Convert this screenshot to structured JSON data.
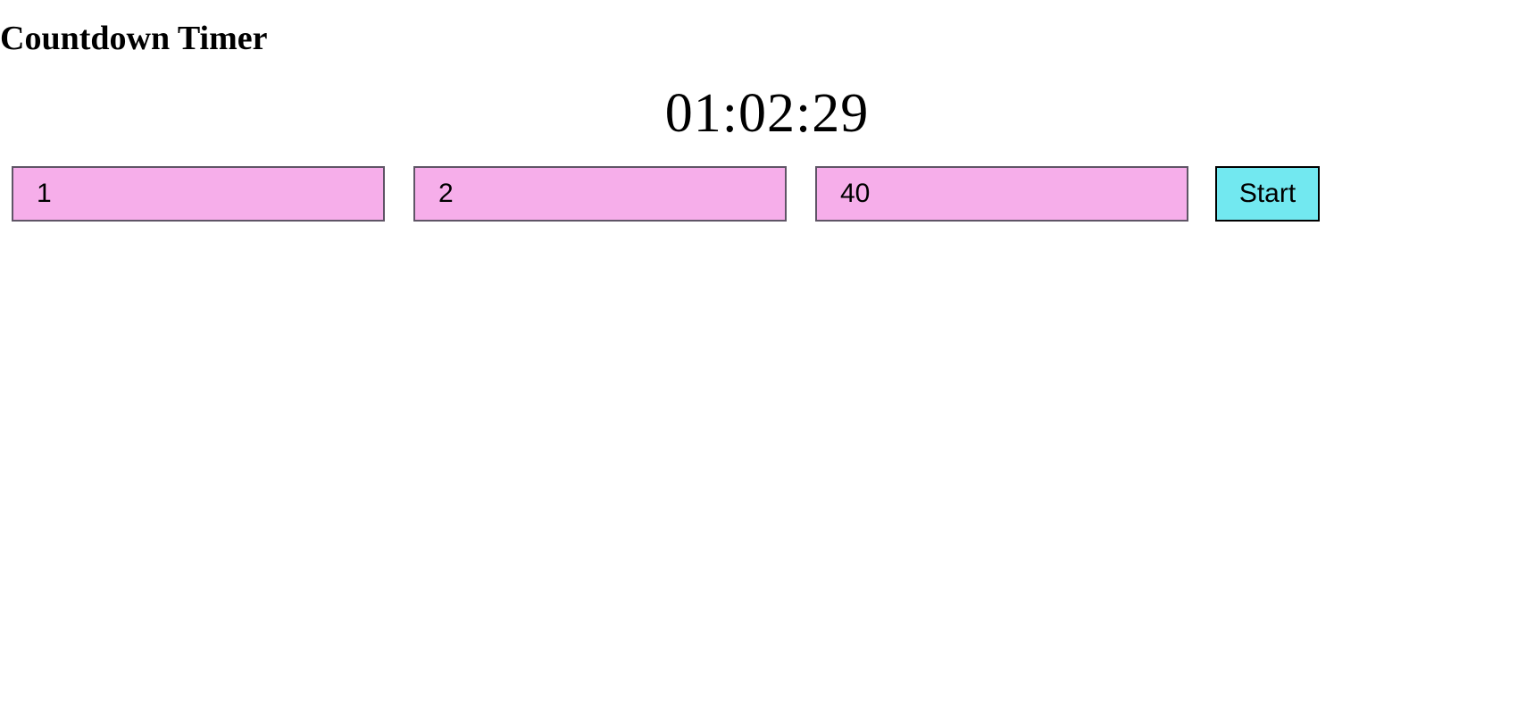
{
  "page": {
    "title": "Countdown Timer"
  },
  "timer": {
    "display": "01:02:29"
  },
  "inputs": {
    "hours": "1",
    "minutes": "2",
    "seconds": "40"
  },
  "controls": {
    "start_label": "Start"
  },
  "colors": {
    "input_background": "#f6aeea",
    "button_background": "#72e8f0",
    "text": "#000000",
    "page_background": "#ffffff"
  }
}
